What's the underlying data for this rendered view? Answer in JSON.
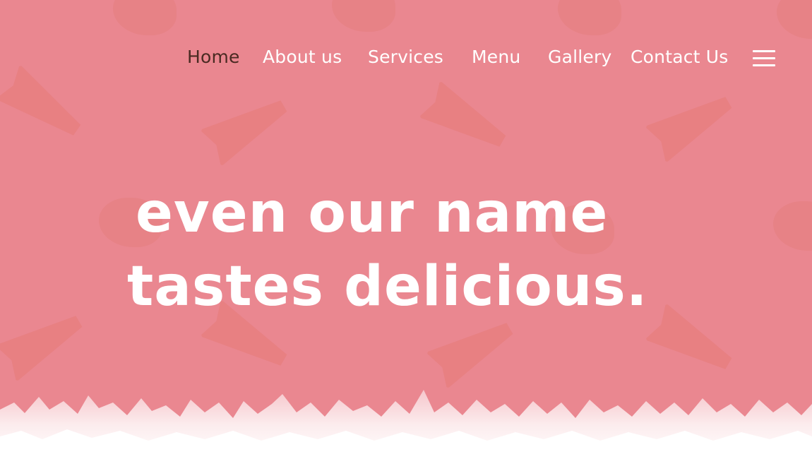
{
  "nav": {
    "items": [
      "Home",
      "About us",
      "Services",
      "Menu",
      "Gallery",
      "Contact Us"
    ],
    "active": "Home"
  },
  "hero": {
    "headline_line1": "Even our name",
    "headline_line2": "tastes delicious."
  },
  "colors": {
    "background": "#ea8790",
    "nav_text": "#ffffff",
    "nav_active": "#4a2a22",
    "headline": "#ffffff"
  },
  "icons": [
    "hamburger-menu-icon"
  ]
}
